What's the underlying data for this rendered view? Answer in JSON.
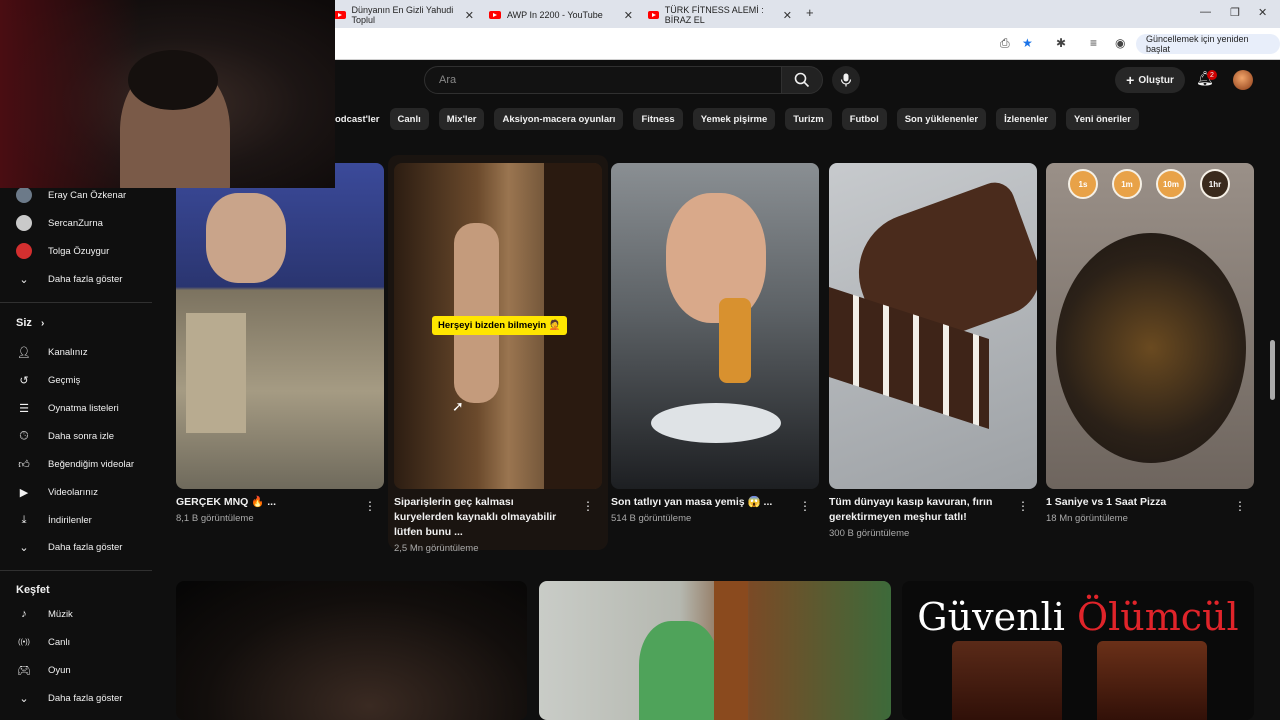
{
  "browser": {
    "tabs": [
      {
        "title": "Dünyanın En Gizli Yahudi Toplul"
      },
      {
        "title": "AWP In 2200 - YouTube"
      },
      {
        "title": "TÜRK FİTNESS ALEMİ : BİRAZ EL"
      }
    ],
    "close_glyph": "✕",
    "new_tab_glyph": "+",
    "update_label": "Güncellemek için yeniden başlat",
    "window_controls": [
      "—",
      "❐",
      "✕"
    ]
  },
  "header": {
    "search_placeholder": "Ara",
    "create_label": "Oluştur",
    "notification_count": "2"
  },
  "chips": [
    "odcast'ler",
    "Canlı",
    "Mix'ler",
    "Aksiyon-macera oyunları",
    "Fitness",
    "Yemek pişirme",
    "Turizm",
    "Futbol",
    "Son yüklenenler",
    "İzlenenler",
    "Yeni öneriler"
  ],
  "sidebar": {
    "subscriptions": [
      {
        "name": "Eray Can Özkenar",
        "color": "#6c7a89"
      },
      {
        "name": "SercanZurna",
        "color": "#c9c9c9"
      },
      {
        "name": "Tolga Özuygur",
        "color": "#d32f2f"
      }
    ],
    "show_more": "Daha fazla göster",
    "you_section": "Siz",
    "you_items": [
      {
        "label": "Kanalınız",
        "icon": "person-icon"
      },
      {
        "label": "Geçmiş",
        "icon": "history-icon"
      },
      {
        "label": "Oynatma listeleri",
        "icon": "playlist-icon"
      },
      {
        "label": "Daha sonra izle",
        "icon": "clock-icon"
      },
      {
        "label": "Beğendiğim videolar",
        "icon": "thumbs-up-icon"
      },
      {
        "label": "Videolarınız",
        "icon": "video-icon"
      },
      {
        "label": "İndirilenler",
        "icon": "download-icon"
      }
    ],
    "show_more_2": "Daha fazla göster",
    "explore_section": "Keşfet",
    "explore_items": [
      {
        "label": "Müzik",
        "icon": "music-icon"
      },
      {
        "label": "Canlı",
        "icon": "live-icon"
      },
      {
        "label": "Oyun",
        "icon": "gaming-icon"
      }
    ],
    "show_more_3": "Daha fazla göster"
  },
  "shorts": [
    {
      "title": "GERÇEK MNQ 🔥 ...",
      "views": "8,1 B görüntüleme"
    },
    {
      "title": "Siparişlerin geç kalması kuryelerden kaynaklı olmayabilir lütfen bunu ...",
      "views": "2,5 Mn görüntüleme",
      "caption": "Herşeyi bizden bilmeyin 🤦"
    },
    {
      "title": "Son tatlıyı yan masa yemiş 😱 ...",
      "views": "514 B görüntüleme"
    },
    {
      "title": "Tüm dünyayı kasıp kavuran, fırın gerektirmeyen meşhur tatlı!",
      "views": "300 B görüntüleme"
    },
    {
      "title": "1 Saniye vs 1 Saat Pizza",
      "views": "18 Mn görüntüleme",
      "badges": [
        "1s",
        "1m",
        "10m",
        "1hr"
      ]
    }
  ],
  "row2": {
    "thumb3_text_a": "Güvenli",
    "thumb3_text_b": "Ölümcül"
  },
  "colors": {
    "accent": "#ff0000",
    "caption": "#ffe600",
    "ölümcül": "#e0242a"
  }
}
